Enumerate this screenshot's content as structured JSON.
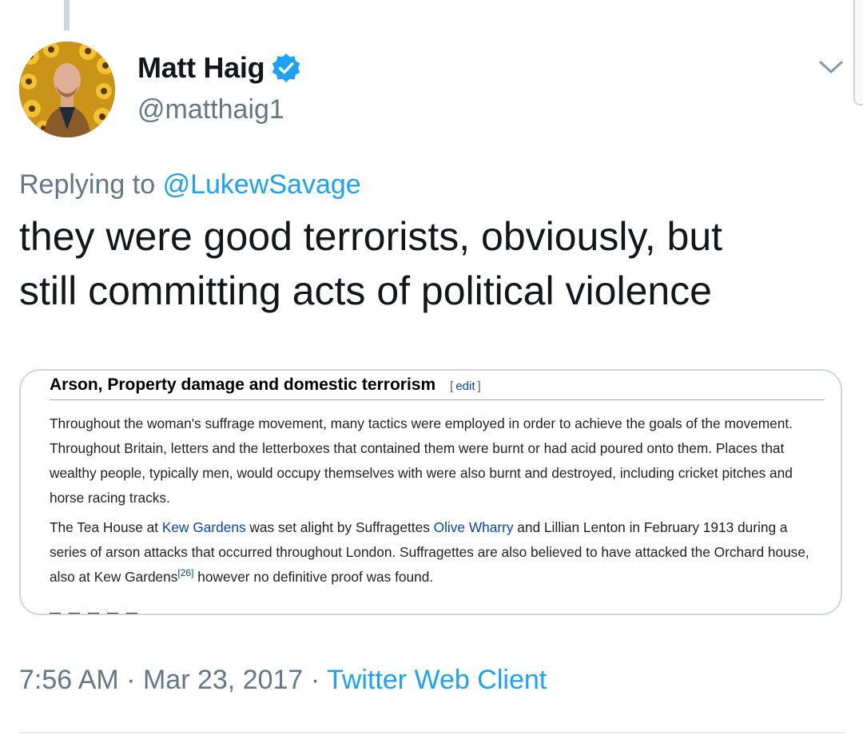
{
  "tweet": {
    "author": {
      "display_name": "Matt Haig",
      "handle": "@matthaig1",
      "verified": true,
      "avatar_icon": "profile-photo-sunflowers"
    },
    "reply_prefix": "Replying to",
    "reply_to": "@LukewSavage",
    "text_line1": "they were good terrorists, obviously, but",
    "text_line2": "still committing acts of political violence",
    "time": "7:56 AM",
    "separator": "·",
    "date": "Mar 23, 2017",
    "client": "Twitter Web Client"
  },
  "media": {
    "heading": "Arson, Property damage and domestic terrorism",
    "edit_open": "[",
    "edit_label": "edit",
    "edit_close": "]",
    "para1": "Throughout the woman's suffrage movement, many tactics were employed in order to achieve the goals of the movement. Throughout Britain, letters and the letterboxes that contained them were burnt or had acid poured onto them. Places that wealthy people, typically men, would occupy themselves with were also burnt and destroyed, including cricket pitches and horse racing tracks.",
    "para2_a": "The Tea House at ",
    "para2_link1": "Kew Gardens",
    "para2_b": " was set alight by Suffragettes ",
    "para2_link2": "Olive Wharry",
    "para2_c": " and Lillian Lenton in February 1913 during a series of arson attacks that occurred throughout London. Suffragettes are also believed to have attacked the Orchard house, also at Kew Gardens",
    "para2_ref": "[26]",
    "para2_d": " however no definitive proof was found."
  },
  "colors": {
    "text": "#14171a",
    "secondary": "#657786",
    "accent": "#1da1f2",
    "wiki_link": "#0645ad",
    "border": "#ccd6dd"
  }
}
